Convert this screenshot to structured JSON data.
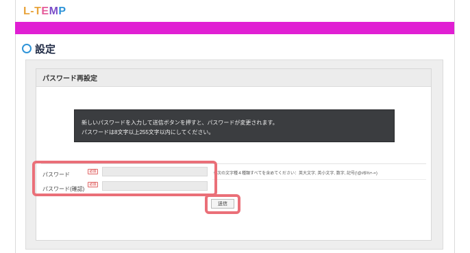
{
  "header": {
    "logo": {
      "parts": [
        "L",
        "-",
        "T",
        "E",
        "M",
        "P"
      ],
      "colors": [
        "#e8a33a",
        "#e8a33a",
        "#e8a33a",
        "#e55a9a",
        "#7a4dc8",
        "#2d93d8"
      ]
    },
    "bar_color": "#e01fd3"
  },
  "page": {
    "title": "設定",
    "title_icon": "ring-icon"
  },
  "section": {
    "title": "パスワード再設定"
  },
  "notice": {
    "line1": "新しいパスワードを入力して送信ボタンを押すと、パスワードが変更されます。",
    "line2": "パスワードは8文字以上255文字以内にしてください。"
  },
  "form": {
    "password": {
      "label": "パスワード",
      "required": "必須",
      "value": ""
    },
    "password_confirm": {
      "label": "パスワード(確認)",
      "required": "必須",
      "value": ""
    },
    "hint": "※次の文字種４種類すべてを含めてください：英大文字, 英小文字, 数字, 記号(!@#$%+-=)",
    "submit_label": "送信"
  },
  "annotations": {
    "highlight_color": "#ea6f78"
  }
}
